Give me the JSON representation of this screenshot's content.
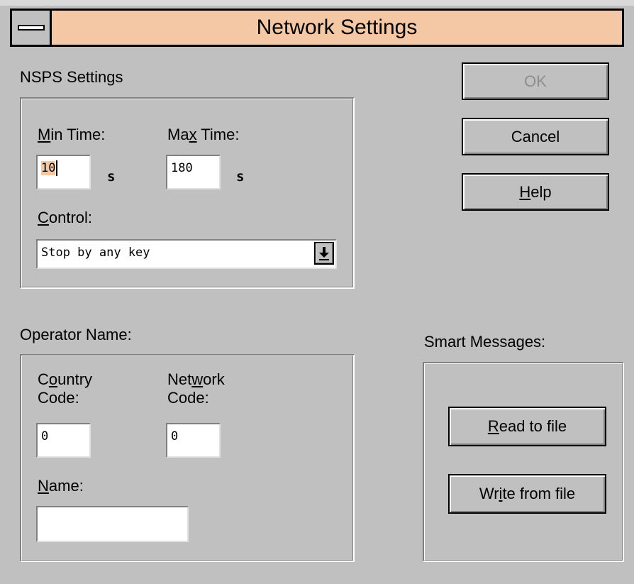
{
  "window": {
    "title": "Network Settings",
    "system_menu_icon": "system-menu-icon"
  },
  "nsps": {
    "heading": "NSPS Settings",
    "min_time": {
      "label_prefix": "",
      "label_accel": "M",
      "label_rest": "in Time:",
      "value": "10",
      "unit": "s"
    },
    "max_time": {
      "label_prefix": "Ma",
      "label_accel": "x",
      "label_rest": " Time:",
      "value": "180",
      "unit": "s"
    },
    "control": {
      "label_accel": "C",
      "label_rest": "ontrol:",
      "value": "Stop by any key",
      "dropdown_icon": "arrow-down-bar-icon"
    }
  },
  "buttons": {
    "ok": "OK",
    "cancel": "Cancel",
    "help_accel": "H",
    "help_rest": "elp",
    "read_accel": "R",
    "read_rest": "ead to file",
    "write_prefix": "Wr",
    "write_accel": "i",
    "write_rest": "te from file"
  },
  "operator": {
    "heading": "Operator Name:",
    "country_code": {
      "line1_prefix": "C",
      "line1_accel": "o",
      "line1_rest": "untry",
      "line2": "Code:",
      "value": "0"
    },
    "network_code": {
      "line1_prefix": "Net",
      "line1_accel": "w",
      "line1_rest": "ork",
      "line2": "Code:",
      "value": "0"
    },
    "name": {
      "label_accel": "N",
      "label_rest": "ame:",
      "value": ""
    }
  },
  "smart_messages": {
    "heading": "Smart Messages:"
  }
}
